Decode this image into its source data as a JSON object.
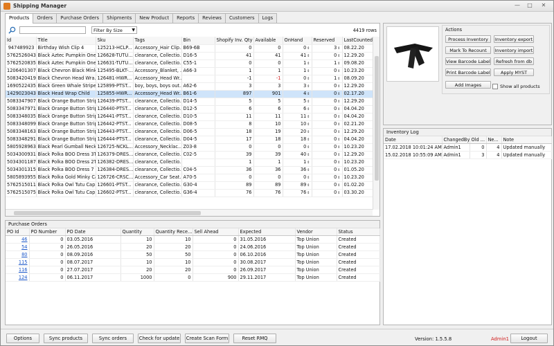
{
  "window": {
    "title": "Shipping Manager"
  },
  "tabs": [
    "Products",
    "Orders",
    "Purchase Orders",
    "Shipments",
    "New Product",
    "Reports",
    "Reviews",
    "Customers",
    "Logs"
  ],
  "products": {
    "filter_label": "Filter By Size",
    "row_count": "4419 rows",
    "columns": [
      "Id",
      "Title",
      "Sku",
      "Tags",
      "Bin",
      "Shopify Inv. Qty",
      "Available",
      "OnHand",
      "Reserved",
      "LastCounted"
    ],
    "rows": [
      [
        "947489923",
        "Birthday Wish Clip 4",
        "125213-HCLP...",
        "Accessory_Hair Clip...",
        "B69-6B",
        "0",
        "0",
        "0",
        "3",
        "08.22.20"
      ],
      [
        "5762526043",
        "Black Aztec Pumpkin One...",
        "126628-TUTU...",
        "clearance, Collectio...",
        "D16-5",
        "41",
        "41",
        "41",
        "0",
        "12.29.20"
      ],
      [
        "5762520835",
        "Black Aztec Pumpkin One...",
        "126631-TUTU...",
        "clearance, Collectio...",
        "C55-1",
        "0",
        "0",
        "1",
        "1",
        "09.08.20"
      ],
      [
        "1206401307",
        "Black Chevron Black Mink...",
        "125495-BLKT-...",
        "Accessory_Blanket, ...",
        "A66-3",
        "1",
        "1",
        "1",
        "0",
        "10.23.20"
      ],
      [
        "5083420419",
        "Black Chevron Head Wra...",
        "126481-HWR...",
        "Accessory_Head Wr...",
        "",
        "-1",
        "-1",
        "0",
        "1",
        "08.09.20"
      ],
      [
        "1690522435",
        "Black Green Whale Stripe ...",
        "125899-PTST...",
        "boy, boys, boys out...",
        "A62-6",
        "3",
        "3",
        "3",
        "0",
        "12.29.20"
      ],
      [
        "1429023043",
        "Black Head Wrap Child",
        "125855-HWR...",
        "Accessory_Head Wr...",
        "B61-6",
        "897",
        "901",
        "4",
        "0",
        "02.17.20"
      ],
      [
        "5083347907",
        "Black Orange Button Strip...",
        "126439-PTST...",
        "clearance, Collectio...",
        "D14-5",
        "5",
        "5",
        "5",
        "0",
        "12.29.20"
      ],
      [
        "5083347971",
        "Black Orange Button Strip...",
        "126440-PTST...",
        "clearance, Collectio...",
        "D12-5",
        "6",
        "6",
        "6",
        "0",
        "04.04.20"
      ],
      [
        "5083348035",
        "Black Orange Button Strip...",
        "126441-PTST...",
        "clearance, Collectio...",
        "D10-5",
        "11",
        "11",
        "11",
        "0",
        "04.04.20"
      ],
      [
        "5083348099",
        "Black Orange Button Strip...",
        "126442-PTST...",
        "clearance, Collectio...",
        "D08-5",
        "8",
        "10",
        "10",
        "0",
        "02.21.20"
      ],
      [
        "5083348163",
        "Black Orange Button Strip...",
        "126443-PTST...",
        "clearance, Collectio...",
        "D06-5",
        "18",
        "19",
        "20",
        "0",
        "12.29.20"
      ],
      [
        "5083348291",
        "Black Orange Button Strip...",
        "126444-PTST...",
        "clearance, Collectio...",
        "D04-5",
        "17",
        "18",
        "18",
        "0",
        "04.04.20"
      ],
      [
        "5805928963",
        "Black Pearl Gumball Neckl...",
        "126725-NCKL...",
        "Accessory_Necklac...",
        "Z03-8",
        "0",
        "0",
        "0",
        "0",
        "10.23.20"
      ],
      [
        "5034300931",
        "Black Polka BOO Dress 3T...",
        "126379-DRES...",
        "clearance, Collectio...",
        "C02-5",
        "39",
        "39",
        "40",
        "0",
        "12.29.20"
      ],
      [
        "5034301187",
        "Black Polka BOO Dress 2T...",
        "126382-DRES...",
        "clearance, Collectio...",
        "",
        "1",
        "1",
        "1",
        "0",
        "10.23.20"
      ],
      [
        "5034301315",
        "Black Polka BOO Dress 7 (...",
        "126384-DRES...",
        "clearance, Collectio...",
        "C04-5",
        "36",
        "36",
        "36",
        "0",
        "01.05.20"
      ],
      [
        "5805893955",
        "Black Polka Gold Minky Ca...",
        "126726-CRSC...",
        "Accessory_Car Seat...",
        "A70-5",
        "0",
        "0",
        "0",
        "0",
        "10.23.20"
      ],
      [
        "5762515011",
        "Black Polka Owl Tutu Cap...",
        "126601-PTST...",
        "clearance, Collectio...",
        "G30-4",
        "89",
        "89",
        "89",
        "0",
        "01.02.20"
      ],
      [
        "5762515075",
        "Black Polka Owl Tutu Cap...",
        "126602-PTST...",
        "clearance, Collectio...",
        "G36-4",
        "76",
        "76",
        "76",
        "0",
        "03.30.20"
      ]
    ]
  },
  "actions": {
    "label": "Actions",
    "buttons": [
      "Process Inventory",
      "Inventory export",
      "Mark To Recount",
      "Inventory import",
      "View Barcode Label",
      "Refresh from db",
      "Print Barcode Label",
      "Apply MYST",
      "Add Images"
    ],
    "show_all_label": "Show all products"
  },
  "inventory_log": {
    "title": "Inventory Log",
    "columns": [
      "Date",
      "ChangedBy",
      "Old ...",
      "Ne...",
      "Note"
    ],
    "rows": [
      [
        "17.02.2018 10:01:24 AM",
        "Admin1",
        "0",
        "4",
        "Updated manually"
      ],
      [
        "15.02.2018 10:55:09 AM",
        "Admin1",
        "3",
        "4",
        "Updated manually"
      ]
    ]
  },
  "purchase_orders": {
    "title": "Purchase Orders",
    "columns": [
      "PO Id",
      "PO Number",
      "PO Date",
      "Quantity",
      "Quantity Rece...",
      "Sell Ahead",
      "Expected",
      "Vendor",
      "Status"
    ],
    "rows": [
      [
        "46",
        "0",
        "03.05.2016",
        "10",
        "10",
        "0",
        "31.05.2016",
        "Top Union",
        "Created"
      ],
      [
        "54",
        "0",
        "26.05.2016",
        "20",
        "20",
        "0",
        "24.06.2016",
        "Top Union",
        "Created"
      ],
      [
        "80",
        "0",
        "08.09.2016",
        "50",
        "50",
        "0",
        "06.10.2016",
        "Top Union",
        "Created"
      ],
      [
        "115",
        "0",
        "08.07.2017",
        "10",
        "10",
        "0",
        "30.08.2017",
        "Top Union",
        "Created"
      ],
      [
        "116",
        "0",
        "27.07.2017",
        "20",
        "20",
        "0",
        "26.09.2017",
        "Top Union",
        "Created"
      ],
      [
        "124",
        "0",
        "06.11.2017",
        "1000",
        "0",
        "900",
        "29.11.2017",
        "Top Union",
        "Created"
      ]
    ]
  },
  "footer": {
    "buttons": [
      "Options",
      "Sync products",
      "Sync orders",
      "Check for update",
      "Create Scan Form",
      "Reset RMQ",
      "Logout"
    ],
    "version": "Version: 1.5.5.8",
    "user": "Admin1"
  }
}
